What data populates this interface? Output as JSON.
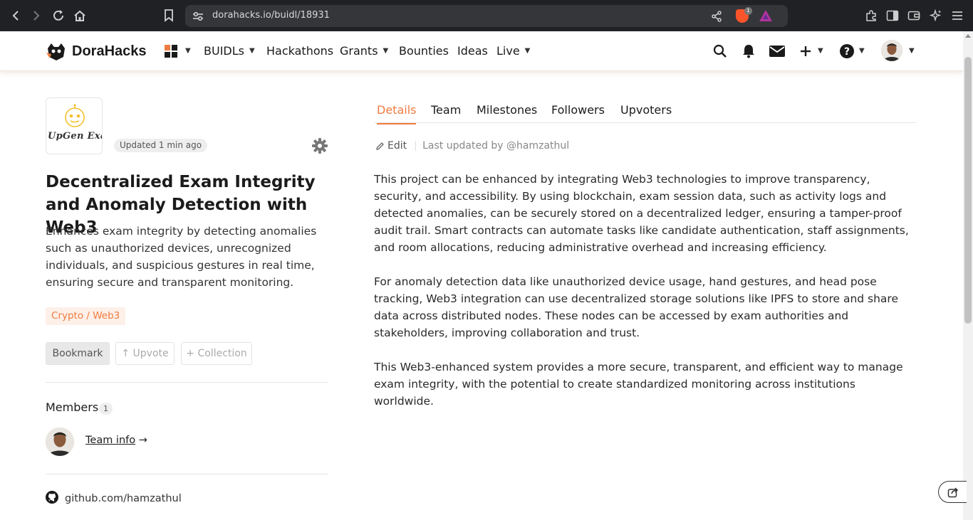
{
  "browser": {
    "url": "dorahacks.io/buidl/18931",
    "shields_count": "1"
  },
  "header": {
    "brand": "DoraHacks",
    "nav": [
      "BUIDLs",
      "Hackathons",
      "Grants",
      "Bounties",
      "Ideas",
      "Live"
    ]
  },
  "project": {
    "logo_text": "UpGen Exam",
    "updated": "Updated 1 min ago",
    "title": "Decentralized Exam Integrity and Anomaly Detection with Web3",
    "description": "Enhances exam integrity by detecting anomalies such as unauthorized devices, unrecognized individuals, and suspicious gestures in real time, ensuring secure and transparent monitoring.",
    "tag": "Crypto / Web3",
    "bookmark_label": "Bookmark",
    "upvote_label": "↑ Upvote",
    "collection_label": "+ Collection",
    "members_title": "Members",
    "members_count": "1",
    "team_info": "Team info",
    "team_arrow": "→",
    "github": "github.com/hamzathul"
  },
  "tabs": [
    "Details",
    "Team",
    "Milestones",
    "Followers",
    "Upvoters"
  ],
  "details": {
    "edit_label": "Edit",
    "last_updated": "Last updated by @hamzathul",
    "paragraphs": [
      "This project can be enhanced by integrating Web3 technologies to improve transparency, security, and accessibility. By using blockchain, exam session data, such as activity logs and detected anomalies, can be securely stored on a decentralized ledger, ensuring a tamper-proof audit trail. Smart contracts can automate tasks like candidate authentication, staff assignments, and room allocations, reducing administrative overhead and increasing efficiency.",
      "For anomaly detection data like unauthorized device usage, hand gestures, and head pose tracking, Web3 integration can use decentralized storage solutions like IPFS to store and share data across distributed nodes. These nodes can be accessed by exam authorities and stakeholders, improving collaboration and trust.",
      "This Web3-enhanced system provides a more secure, transparent, and efficient way to manage exam integrity, with the potential to create standardized monitoring across institutions worldwide."
    ]
  },
  "colors": {
    "accent": "#f07b3f",
    "tag_bg": "#fdf0e8",
    "chrome_bg": "#202124"
  },
  "icons": [
    "back-icon",
    "forward-icon",
    "reload-icon",
    "home-icon",
    "bookmark-icon",
    "site-settings-icon",
    "share-icon",
    "brave-shields-icon",
    "brave-rewards-icon",
    "extensions-icon",
    "sidebar-icon",
    "wallet-icon",
    "leo-icon",
    "menu-icon",
    "apps-grid-icon",
    "search-icon",
    "bell-icon",
    "mail-icon",
    "plus-icon",
    "help-icon",
    "gear-icon",
    "pencil-icon",
    "github-icon"
  ]
}
